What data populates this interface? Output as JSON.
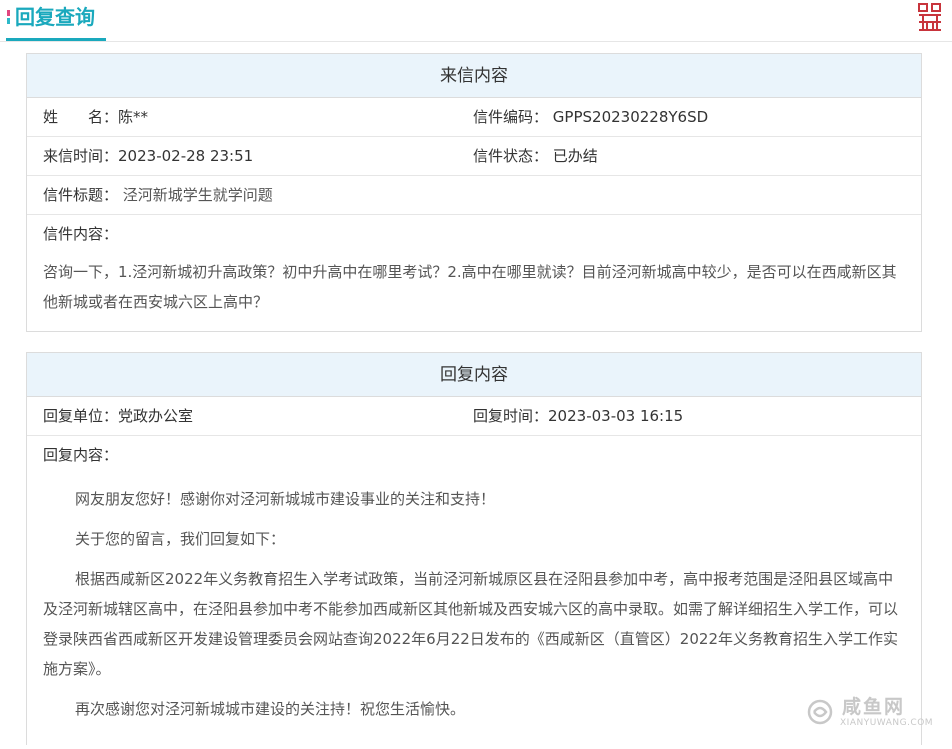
{
  "header": {
    "title": "回复查询"
  },
  "letter": {
    "heading": "来信内容",
    "name_label": "姓　　名：",
    "name_value": "陈**",
    "code_label": "信件编码：",
    "code_value": "GPPS20230228Y6SD",
    "time_label": "来信时间：",
    "time_value": "2023-02-28 23:51",
    "status_label": "信件状态：",
    "status_value": "已办结",
    "subject_label": "信件标题：",
    "subject_value": "泾河新城学生就学问题",
    "content_label": "信件内容：",
    "content_text": "咨询一下，1.泾河新城初升高政策？初中升高中在哪里考试？2.高中在哪里就读？目前泾河新城高中较少，是否可以在西咸新区其他新城或者在西安城六区上高中？"
  },
  "reply": {
    "heading": "回复内容",
    "unit_label": "回复单位：",
    "unit_value": "党政办公室",
    "time_label": "回复时间：",
    "time_value": "2023-03-03 16:15",
    "content_label": "回复内容：",
    "paragraphs": [
      "网友朋友您好！感谢你对泾河新城城市建设事业的关注和支持！",
      "关于您的留言，我们回复如下：",
      "根据西咸新区2022年义务教育招生入学考试政策，当前泾河新城原区县在泾阳县参加中考，高中报考范围是泾阳县区域高中及泾河新城辖区高中，在泾阳县参加中考不能参加西咸新区其他新城及西安城六区的高中录取。如需了解详细招生入学工作，可以登录陕西省西咸新区开发建设管理委员会网站查询2022年6月22日发布的《西咸新区（直管区）2022年义务教育招生入学工作实施方案》。",
      "再次感谢您对泾河新城城市建设的关注持！祝您生活愉快。"
    ]
  },
  "watermark": {
    "name": "咸鱼网",
    "url": "XIANYUWANG.COM"
  },
  "colors": {
    "accent": "#1aa9bd",
    "marker_pink": "#e2457f",
    "panel_head_bg": "#eaf4fb",
    "seal_red": "#c8343c"
  }
}
